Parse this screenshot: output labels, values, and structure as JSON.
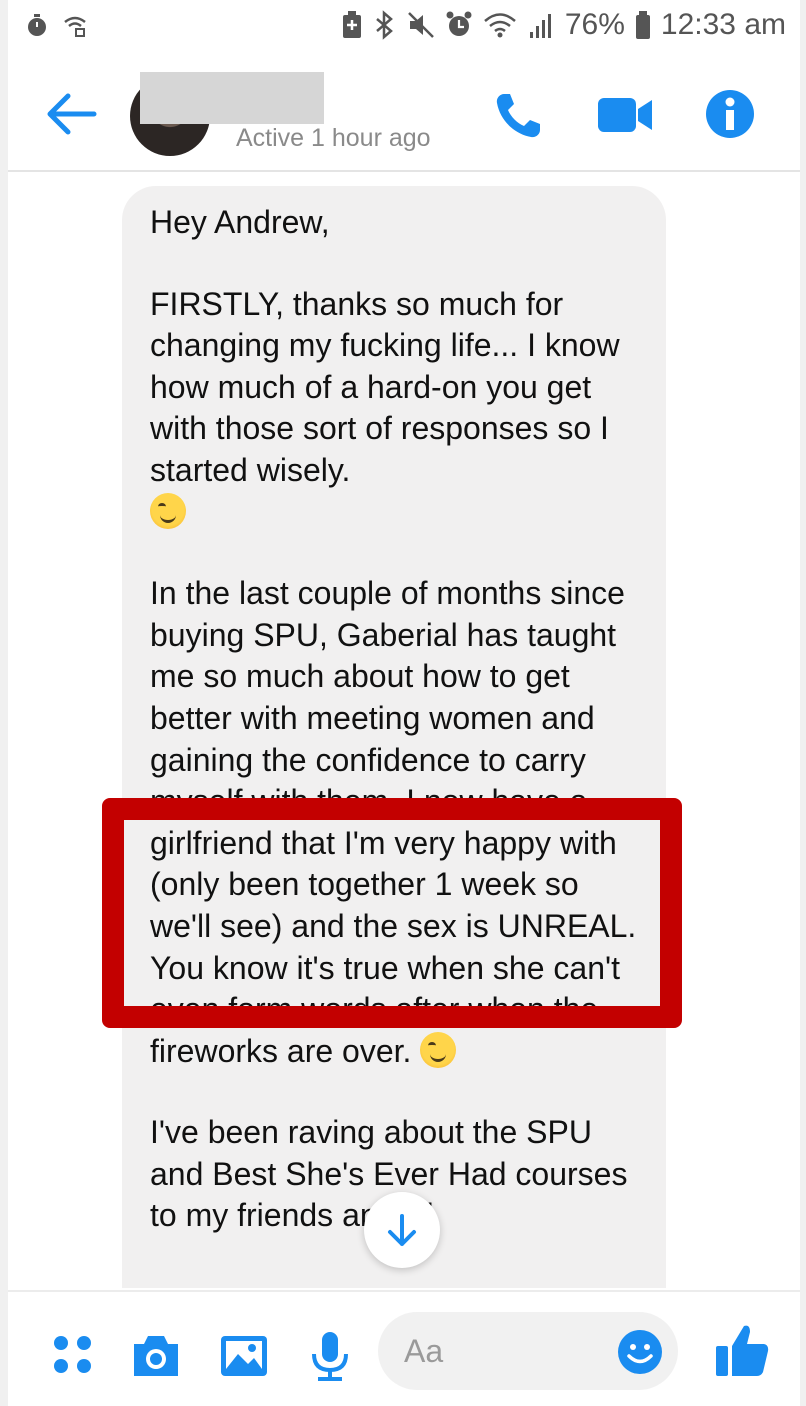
{
  "status_bar": {
    "battery": "76%",
    "time": "12:33 am"
  },
  "header": {
    "active_status": "Active 1 hour ago"
  },
  "message": {
    "greeting": "Hey Andrew,",
    "para1": "FIRSTLY, thanks so much for changing my fucking life... I know how much of a hard-on you get with those sort of responses so I started wisely.",
    "para2a": "In the last couple of months since buying SPU, Gaberial has taught me so much about how to get better with meeting women and gaining the",
    "para2b": "confidence to carry myself with them. I now have a girlfriend that I'm very happy with (only been together 1 week so we'll see) and the sex is UNREAL.",
    "para2c": "You know it's true when she can't even form words after when the fireworks are over.",
    "para3": "I've been raving about the SPU and Best She's Ever Had courses to my friends and I'll"
  },
  "composer": {
    "placeholder": "Aa"
  },
  "colors": {
    "accent": "#1a8cf0",
    "highlight": "#c30000",
    "bubble": "#f1f0f0"
  }
}
